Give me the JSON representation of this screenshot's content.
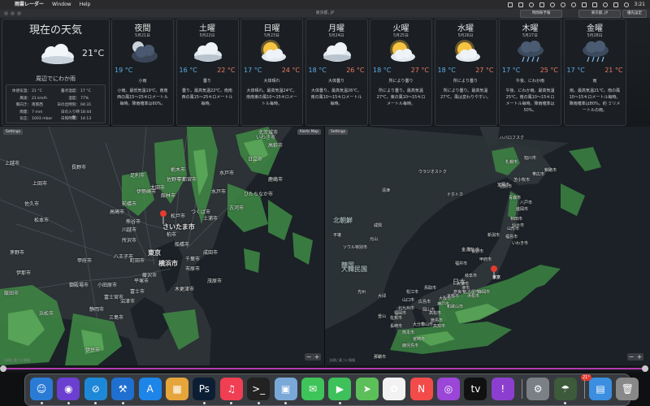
{
  "menubar": {
    "app_name": "雨雲レーダー",
    "menus": [
      "Window",
      "Help"
    ],
    "clock": "3:21"
  },
  "toolbar": {
    "title": "東京都, JP",
    "buttons": [
      "時間毎予報",
      "東京都, JP",
      "優先設定"
    ]
  },
  "current": {
    "title": "現在の天気",
    "temp": "21°C",
    "description": "周辺でにわか雨",
    "details": [
      {
        "l1": "体感気温：",
        "v1": "21 °C",
        "l2": "露点温度：",
        "v2": "17 °C"
      },
      {
        "l1": "風速：",
        "v1": "21 km/h",
        "l2": "湿度：",
        "v2": "77%"
      },
      {
        "l1": "風向き：",
        "v1": "南南西",
        "l2": "日の出時刻：",
        "v2": "04:31"
      },
      {
        "l1": "雨量：",
        "v1": "7 mm",
        "l2": "日の入り時刻：",
        "v2": "18:44"
      },
      {
        "l1": "気圧：",
        "v1": "1003 mbar",
        "l2": "日照時間：",
        "v2": "14:13"
      }
    ]
  },
  "forecast": [
    {
      "name": "夜間",
      "date": "5月21日",
      "icon": "night-cloud-icon",
      "lo": "19 °C",
      "hi": "",
      "cond": "小雨",
      "text": "小雨。最低気温19℃。南南西の風15～25キロメートル毎時。降雨確率は60%。"
    },
    {
      "name": "土曜",
      "date": "5月22日",
      "icon": "cloud-icon",
      "lo": "16 °C",
      "hi": "22 °C",
      "cond": "曇り",
      "text": "曇り。最高気温22℃。南南西の風15～25キロメートル毎時。"
    },
    {
      "name": "日曜",
      "date": "5月23日",
      "icon": "sun-cloud-icon",
      "lo": "17 °C",
      "hi": "24 °C",
      "cond": "大体晴れ",
      "text": "大体晴れ。最高気温24℃。南南東の風10～15キロメートル毎時。"
    },
    {
      "name": "月曜",
      "date": "5月24日",
      "icon": "cloud-icon",
      "lo": "18 °C",
      "hi": "26 °C",
      "cond": "大体曇り",
      "text": "大体曇り。最高気温26℃。南の風10～15キロメートル毎時。"
    },
    {
      "name": "火曜",
      "date": "5月25日",
      "icon": "sun-cloud-icon",
      "lo": "18 °C",
      "hi": "27 °C",
      "cond": "所により曇り",
      "text": "所により曇り。最高気温27℃。東の風10～15キロメートル毎時。"
    },
    {
      "name": "水曜",
      "date": "5月26日",
      "icon": "sun-cloud-icon",
      "lo": "18 °C",
      "hi": "27 °C",
      "cond": "所により曇り",
      "text": "所により曇り。最高気温27℃。風は変わりやすい。"
    },
    {
      "name": "木曜",
      "date": "5月27日",
      "icon": "rain-cloud-icon",
      "lo": "17 °C",
      "hi": "25 °C",
      "cond": "午後、にわか雨",
      "text": "午後、にわか雨。最高気温25℃。南の風10～15キロメートル毎時。降雨確率は50%。"
    },
    {
      "name": "金曜",
      "date": "5月28日",
      "icon": "rain-cloud-icon",
      "lo": "17 °C",
      "hi": "21 °C",
      "cond": "雨",
      "text": "雨。最高気温21℃。南の風10～15キロメートル毎時。降雨確率は80%。約 ミリメートルの雨。"
    }
  ],
  "map_left": {
    "settings": "Settings",
    "alerts": "Alerts Map",
    "legal": "法律に基づく情報",
    "labels": [
      "いわき市",
      "宇都宮市",
      "水戸市",
      "前橋市",
      "高崎市",
      "つくば市",
      "さいたま市",
      "川越市",
      "所沢市",
      "船橋市",
      "千葉市",
      "東京",
      "八王子市",
      "横浜市",
      "市原市",
      "平塚市",
      "甲府市",
      "富士宮市",
      "静岡市",
      "浜松市",
      "長野市",
      "松本市",
      "上越市",
      "藤沢市",
      "町田市",
      "小田原市",
      "富士市",
      "沼津市",
      "三島市",
      "鹿嶋市",
      "日立市",
      "足利市",
      "太田市",
      "館林市",
      "熊谷市",
      "伊勢崎市",
      "佐野市",
      "栃木市",
      "上田市",
      "佐久市",
      "茅野市",
      "伊那市",
      "飯田市",
      "御殿場市",
      "伊豆市",
      "木更津市",
      "茂原市",
      "成田市",
      "柏市",
      "松戸市",
      "古河市",
      "土浦市",
      "水戸市",
      "ひたちなか市",
      "高萩市",
      "北茨城市"
    ]
  },
  "map_right": {
    "settings": "Settings",
    "legal": "法律に基づく情報",
    "labels": [
      "北朝鮮",
      "韓国",
      "日本",
      "大韓民国",
      "平壌",
      "ソウル特別市",
      "ウラジオストク",
      "札幌市",
      "仙台市",
      "東京",
      "大阪市",
      "名古屋市",
      "福岡市",
      "広島市",
      "新潟市",
      "金沢市",
      "函館市",
      "青森市",
      "盛岡市",
      "秋田市",
      "山形市",
      "福島市",
      "京都市",
      "神戸市",
      "岡山市",
      "松山市",
      "高知市",
      "北九州市",
      "長崎市",
      "熊本市",
      "鹿児島市",
      "宮崎市",
      "大分市",
      "那覇市",
      "釜山",
      "大邱",
      "光州",
      "清津",
      "元山",
      "咸興",
      "ハバロフスク",
      "ナホトカ",
      "旭川市",
      "釧路市",
      "帯広市",
      "苫小牧市",
      "室蘭市",
      "八戸市",
      "いわき市",
      "浜松市",
      "静岡市",
      "徳島市",
      "高松市",
      "松江市",
      "鳥取市",
      "富山市",
      "福井市",
      "長野市",
      "甲府市",
      "岐阜市",
      "津市",
      "大津市",
      "奈良市",
      "和歌山市",
      "山口市",
      "佐賀市"
    ]
  },
  "dock": [
    {
      "name": "finder-icon",
      "glyph": "☺",
      "color": "#2a7bd6"
    },
    {
      "name": "siri-icon",
      "glyph": "◉",
      "color": "#6b3fd0"
    },
    {
      "name": "safari-icon",
      "glyph": "⊘",
      "color": "#1e88d8"
    },
    {
      "name": "xcode-icon",
      "glyph": "⚒",
      "color": "#1f6fd0"
    },
    {
      "name": "appstore-icon",
      "glyph": "A",
      "color": "#1d84e8"
    },
    {
      "name": "launchpad-icon",
      "glyph": "▦",
      "color": "#e6a53a"
    },
    {
      "name": "photoshop-icon",
      "glyph": "Ps",
      "color": "#0b1e34"
    },
    {
      "name": "music-icon",
      "glyph": "♫",
      "color": "#f03e53"
    },
    {
      "name": "terminal-icon",
      "glyph": ">_",
      "color": "#222"
    },
    {
      "name": "preview-icon",
      "glyph": "▣",
      "color": "#7aa9d8"
    },
    {
      "name": "messages-icon",
      "glyph": "✉",
      "color": "#3fc45a"
    },
    {
      "name": "facetime-icon",
      "glyph": "▶",
      "color": "#3ec05a"
    },
    {
      "name": "maps-icon",
      "glyph": "➤",
      "color": "#5cbf5a"
    },
    {
      "name": "photos-icon",
      "glyph": "✿",
      "color": "#f2f2f2"
    },
    {
      "name": "news-icon",
      "glyph": "N",
      "color": "#f34a4a"
    },
    {
      "name": "podcasts-icon",
      "glyph": "◎",
      "color": "#9b46d8"
    },
    {
      "name": "appletv-icon",
      "glyph": "tv",
      "color": "#111"
    },
    {
      "name": "feedback-icon",
      "glyph": "!",
      "color": "#8c3fcf"
    },
    {
      "name": "system-preferences-icon",
      "glyph": "⚙",
      "color": "#7b7f86"
    },
    {
      "name": "rain-radar-icon",
      "glyph": "☂",
      "color": "#3d5a3a"
    },
    {
      "name": "downloads-folder-icon",
      "glyph": "▤",
      "color": "#3b8ee0"
    },
    {
      "name": "trash-icon",
      "glyph": "🗑",
      "color": "#888"
    }
  ],
  "dock_badge": "21°"
}
